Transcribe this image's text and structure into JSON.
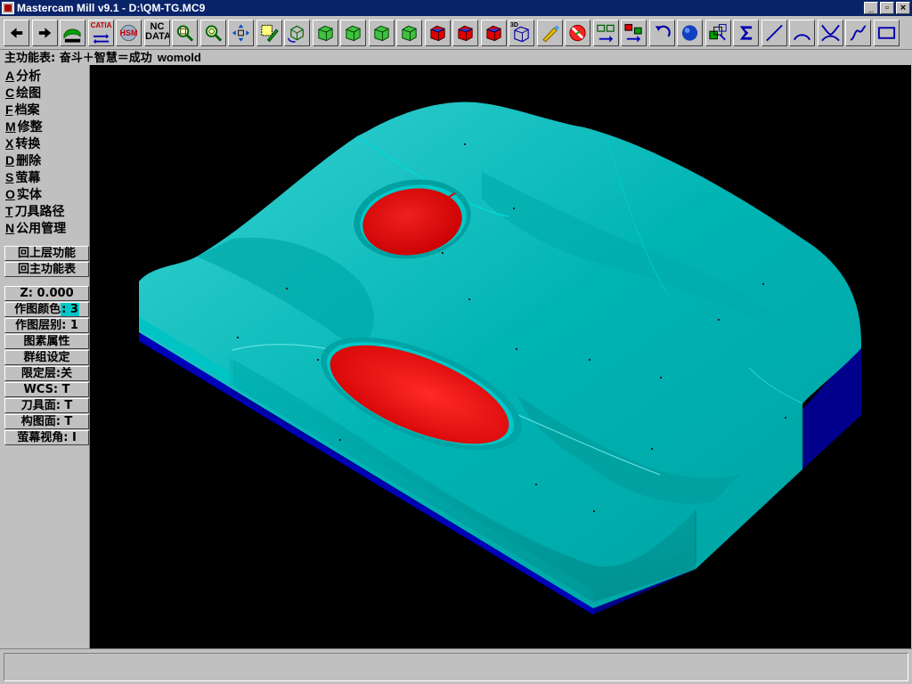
{
  "window": {
    "title": "Mastercam Mill v9.1 - D:\\QM-TG.MC9",
    "controls": {
      "minimize": "_",
      "restore": "▫",
      "close": "×"
    }
  },
  "toolbar": {
    "buttons": [
      {
        "name": "back-arrow-button",
        "icon": "left-arrow"
      },
      {
        "name": "forward-arrow-button",
        "icon": "right-arrow"
      },
      {
        "name": "moldplus-button",
        "icon": "moldplus-logo"
      },
      {
        "name": "catia-translator-button",
        "icon": "catia-transfer",
        "text": "CATIA"
      },
      {
        "name": "hsm-button",
        "icon": "hsm-logo",
        "text": "HSM"
      },
      {
        "name": "nc-data-button",
        "icon": "nc-data",
        "text": "NC DATA"
      },
      {
        "name": "zoom-window-button",
        "icon": "zoom-window"
      },
      {
        "name": "zoom-out-button",
        "icon": "zoom-out"
      },
      {
        "name": "pan-button",
        "icon": "pan-arrows"
      },
      {
        "name": "select-edit-button",
        "icon": "pencil-select"
      },
      {
        "name": "rotate-view-button",
        "icon": "rotate-cube"
      },
      {
        "name": "top-view-button",
        "icon": "wire-cube"
      },
      {
        "name": "front-view-button",
        "icon": "wire-cube"
      },
      {
        "name": "side-view-button",
        "icon": "wire-cube"
      },
      {
        "name": "iso-view-button",
        "icon": "wire-cube"
      },
      {
        "name": "shaded-cube-top-button",
        "icon": "red-cube"
      },
      {
        "name": "shaded-cube-front-button",
        "icon": "red-cube"
      },
      {
        "name": "shaded-cube-side-button",
        "icon": "red-cube"
      },
      {
        "name": "3d-view-button",
        "icon": "cube-3d",
        "text": "3D"
      },
      {
        "name": "brush-button",
        "icon": "brush"
      },
      {
        "name": "no-entry-button",
        "icon": "no-entry"
      },
      {
        "name": "transform-arrange-button",
        "icon": "boxes-arrow"
      },
      {
        "name": "color-boxes-button",
        "icon": "color-boxes"
      },
      {
        "name": "undo-button",
        "icon": "undo-arc"
      },
      {
        "name": "sphere-button",
        "icon": "blue-sphere"
      },
      {
        "name": "multi-select-button",
        "icon": "stack-select"
      },
      {
        "name": "sigma-button",
        "icon": "sigma"
      },
      {
        "name": "line-button",
        "icon": "line"
      },
      {
        "name": "arc-button",
        "icon": "arc"
      },
      {
        "name": "fillet-button",
        "icon": "fillet"
      },
      {
        "name": "spline-button",
        "icon": "spline"
      },
      {
        "name": "rectangle-button",
        "icon": "rectangle"
      }
    ]
  },
  "prompt": {
    "text": "主功能表: 奋斗＋智慧＝成功",
    "suffix": "womold"
  },
  "menu": {
    "items": [
      {
        "key": "A",
        "label": "分析"
      },
      {
        "key": "C",
        "label": "绘图"
      },
      {
        "key": "F",
        "label": "档案"
      },
      {
        "key": "M",
        "label": "修整"
      },
      {
        "key": "X",
        "label": "转换"
      },
      {
        "key": "D",
        "label": "删除"
      },
      {
        "key": "S",
        "label": "萤幕"
      },
      {
        "key": "O",
        "label": "实体"
      },
      {
        "key": "T",
        "label": "刀具路径"
      },
      {
        "key": "N",
        "label": "公用管理"
      }
    ],
    "back_up": "回上层功能",
    "back_main": "回主功能表",
    "z_depth": "Z:  0.000",
    "color_label": "作图颜色",
    "color_value": ": 3",
    "level": "作图层别: 1",
    "attributes": "图素属性",
    "group": "群组设定",
    "mask": "限定层:关",
    "wcs": "WCS:  T",
    "tplane": "刀具面: T",
    "cplane": "构图面: T",
    "gview": "萤幕视角: I"
  },
  "viewport": {
    "background": "#000000",
    "part_color": "#00c0c0",
    "base_color": "#0000a8",
    "pocket_color": "#e00000"
  },
  "statusbar": {
    "text": ""
  }
}
